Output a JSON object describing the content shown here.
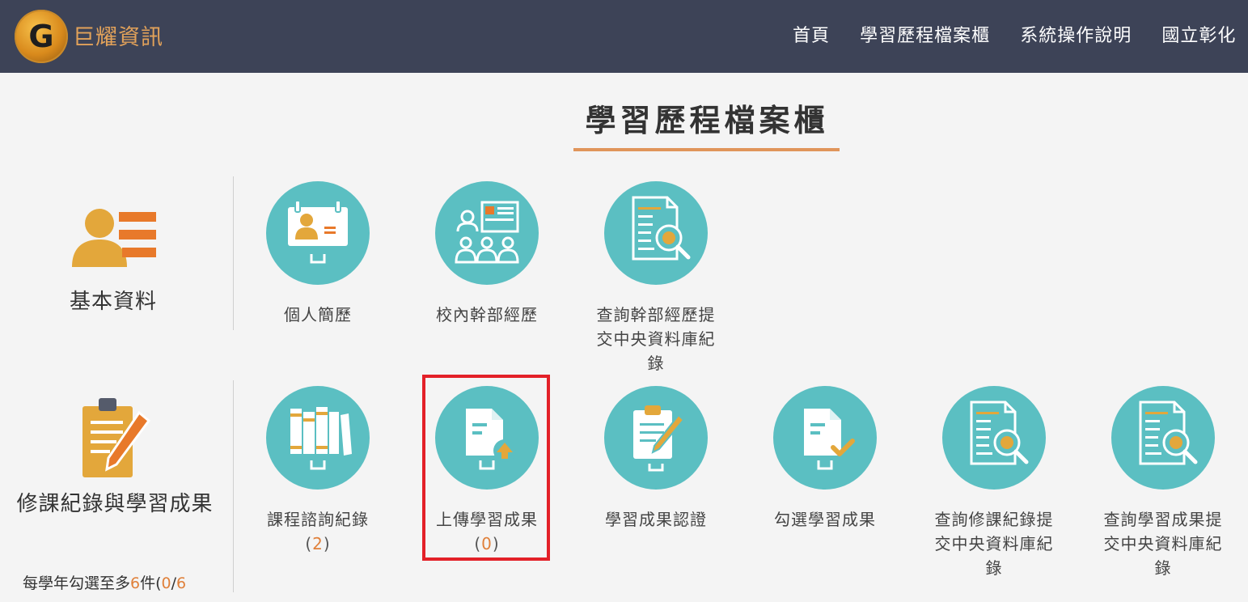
{
  "header": {
    "brand": "巨耀資訊",
    "logo_letter": "G",
    "nav": [
      "首頁",
      "學習歷程檔案櫃",
      "系統操作說明",
      "國立彰化"
    ]
  },
  "page": {
    "title": "學習歷程檔案櫃"
  },
  "sections": [
    {
      "label": "基本資料",
      "icon": "profile-list-icon",
      "tiles": [
        {
          "label": "個人簡歷",
          "icon": "id-card-icon"
        },
        {
          "label": "校內幹部經歷",
          "icon": "team-board-icon"
        },
        {
          "label": "查詢幹部經歷提交中央資料庫紀錄",
          "icon": "document-search-icon"
        }
      ]
    },
    {
      "label": "修課紀錄與學習成果",
      "icon": "clipboard-pencil-icon",
      "quota": {
        "prefix": "每學年勾選至多",
        "max": "6",
        "unit": "件(",
        "current": "0",
        "sep": "/",
        "total": "6"
      },
      "tiles": [
        {
          "label": "課程諮詢紀錄",
          "count_open": "(",
          "count": "2",
          "count_close": ")",
          "icon": "books-icon"
        },
        {
          "label": "上傳學習成果",
          "count_open": "(",
          "count": "0",
          "count_close": ")",
          "icon": "document-upload-icon"
        },
        {
          "label": "學習成果認證",
          "icon": "clipboard-edit-icon"
        },
        {
          "label": "勾選學習成果",
          "icon": "document-check-icon"
        },
        {
          "label": "查詢修課紀錄提交中央資料庫紀錄",
          "icon": "document-search-icon"
        },
        {
          "label": "查詢學習成果提交中央資料庫紀錄",
          "icon": "document-search-icon"
        }
      ]
    }
  ],
  "colors": {
    "navbar": "#3d4357",
    "teal": "#5bbfc2",
    "orange": "#e0803a",
    "gold": "#e3a73b",
    "highlight": "#e32028"
  }
}
